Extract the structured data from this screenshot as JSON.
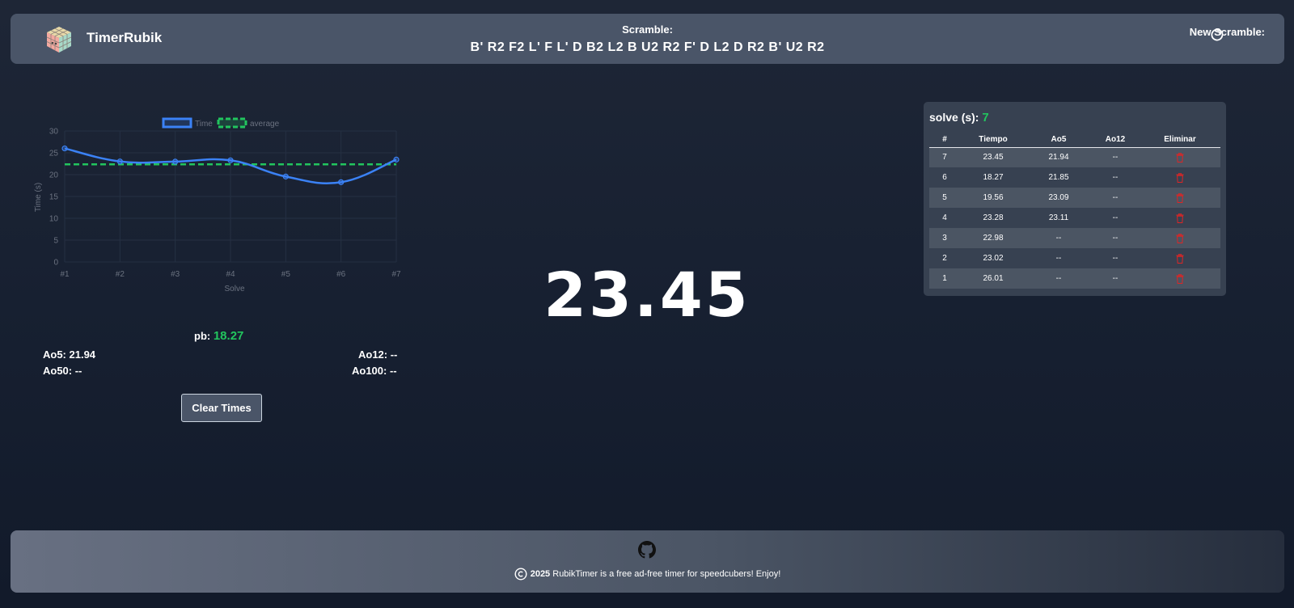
{
  "header": {
    "brand": "TimerRubik",
    "scramble_label": "Scramble:",
    "scramble": "B' R2 F2 L' F L' D B2 L2 B U2 R2 F' D L2 D R2 B' U2 R2",
    "new_scramble_label": "New Scramble:"
  },
  "chart_data": {
    "type": "line",
    "categories": [
      "#1",
      "#2",
      "#3",
      "#4",
      "#5",
      "#6",
      "#7"
    ],
    "series": [
      {
        "name": "Time",
        "values": [
          26.01,
          23.02,
          22.98,
          23.28,
          19.56,
          18.27,
          23.45
        ],
        "color": "#3b82f6"
      },
      {
        "name": "average",
        "values": [
          22.37,
          22.37,
          22.37,
          22.37,
          22.37,
          22.37,
          22.37
        ],
        "color": "#22c55e",
        "dashed": true
      }
    ],
    "xlabel": "Solve",
    "ylabel": "Time (s)",
    "ylim": [
      0,
      30
    ],
    "yticks": [
      "0",
      "5",
      "10",
      "15",
      "20",
      "25",
      "30"
    ],
    "grid": true,
    "legend": "top-center"
  },
  "stats": {
    "pb_label": "pb:",
    "pb_value": "18.27",
    "ao5": "Ao5: 21.94",
    "ao12": "Ao12: --",
    "ao50": "Ao50: --",
    "ao100": "Ao100: --"
  },
  "clear_button": "Clear Times",
  "timer": "23.45",
  "solves": {
    "title_label": "solve (s):",
    "count": "7",
    "headers": [
      "#",
      "Tiempo",
      "Ao5",
      "Ao12",
      "Eliminar"
    ],
    "rows": [
      [
        "7",
        "23.45",
        "21.94",
        "--"
      ],
      [
        "6",
        "18.27",
        "21.85",
        "--"
      ],
      [
        "5",
        "19.56",
        "23.09",
        "--"
      ],
      [
        "4",
        "23.28",
        "23.11",
        "--"
      ],
      [
        "3",
        "22.98",
        "--",
        "--"
      ],
      [
        "2",
        "23.02",
        "--",
        "--"
      ],
      [
        "1",
        "26.01",
        "--",
        "--"
      ]
    ]
  },
  "footer": {
    "year": "2025",
    "text": " RubikTimer is a free ad-free timer for speedcubers! Enjoy!"
  },
  "icons": {
    "refresh": "refresh-icon",
    "github": "github-icon",
    "copyright": "copyright-icon",
    "trash": "trash-icon",
    "logo": "rubik-cube-logo"
  },
  "colors": {
    "accent_green": "#22c55e",
    "accent_blue": "#3b82f6",
    "delete_red": "#dc2626"
  }
}
